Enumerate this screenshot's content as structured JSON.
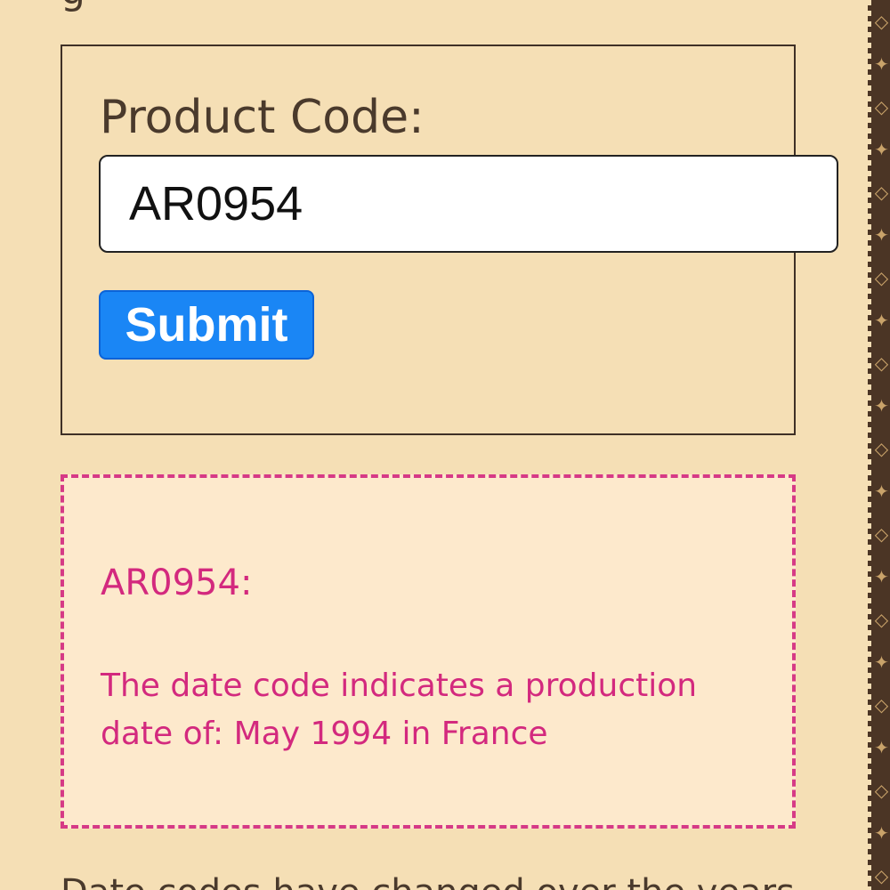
{
  "header": {
    "fragment": "g"
  },
  "form": {
    "label": "Product Code:",
    "input_value": "AR0954",
    "submit_label": "Submit"
  },
  "result": {
    "title": "AR0954:",
    "text": "The date code indicates a production date of: May 1994 in France"
  },
  "footer": {
    "fragment": "Date codes have changed over the years"
  },
  "colors": {
    "page_background": "#f5dfb5",
    "text_brown": "#4a3a2c",
    "submit_blue": "#1a86f5",
    "result_pink": "#d3297e",
    "result_background": "#fde9cc",
    "strip_brown": "#4b3525"
  },
  "icons": {
    "side_strip": "monogram-pattern-icon"
  }
}
